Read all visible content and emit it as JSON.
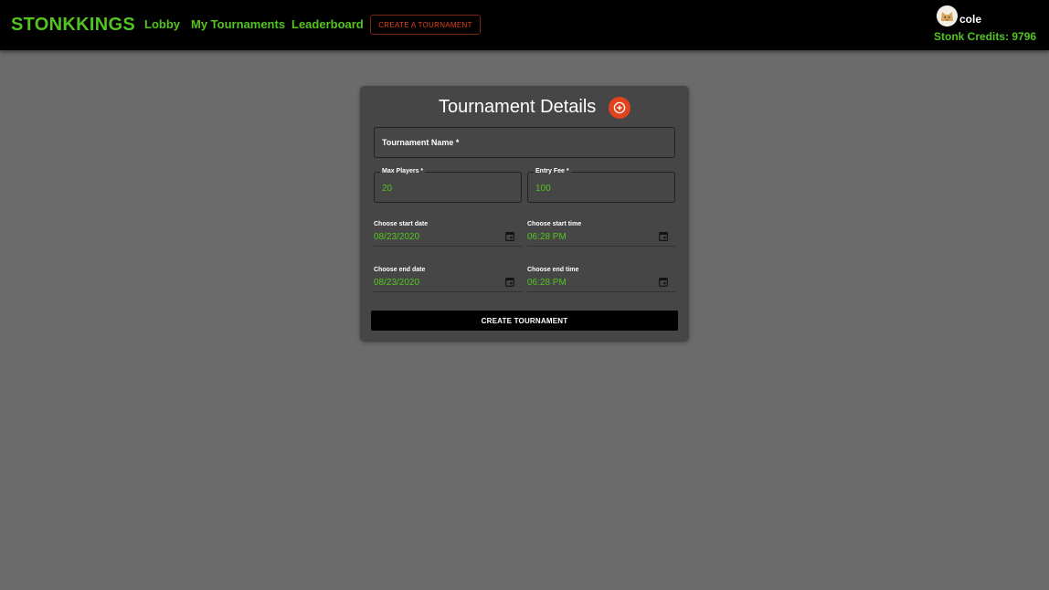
{
  "header": {
    "brand": "STONKKINGS",
    "nav": {
      "lobby": "Lobby",
      "my_tournaments": "My Tournaments",
      "leaderboard": "Leaderboard"
    },
    "create_button": "CREATE A TOURNAMENT",
    "user": {
      "name": "cole",
      "credits": "Stonk Credits: 9796",
      "avatar_icon": "cat-avatar-icon"
    }
  },
  "form": {
    "title": "Tournament Details",
    "add_icon": "add-circle-icon",
    "tournament_name": {
      "label": "Tournament Name *",
      "value": ""
    },
    "max_players": {
      "label": "Max Players *",
      "value": "20"
    },
    "entry_fee": {
      "label": "Entry Fee *",
      "value": "100"
    },
    "start_date": {
      "label": "Choose start date",
      "value": "08/23/2020"
    },
    "start_time": {
      "label": "Choose start time",
      "value": "06:28 PM"
    },
    "end_date": {
      "label": "Choose end date",
      "value": "08/23/2020"
    },
    "end_time": {
      "label": "Choose end time",
      "value": "06:28 PM"
    },
    "submit_label": "CREATE TOURNAMENT"
  },
  "colors": {
    "accent_green": "#53c41f",
    "accent_orange": "#e0431d",
    "page_bg": "#6b6b6b",
    "card_bg": "#464646",
    "bar_bg": "#000000"
  }
}
